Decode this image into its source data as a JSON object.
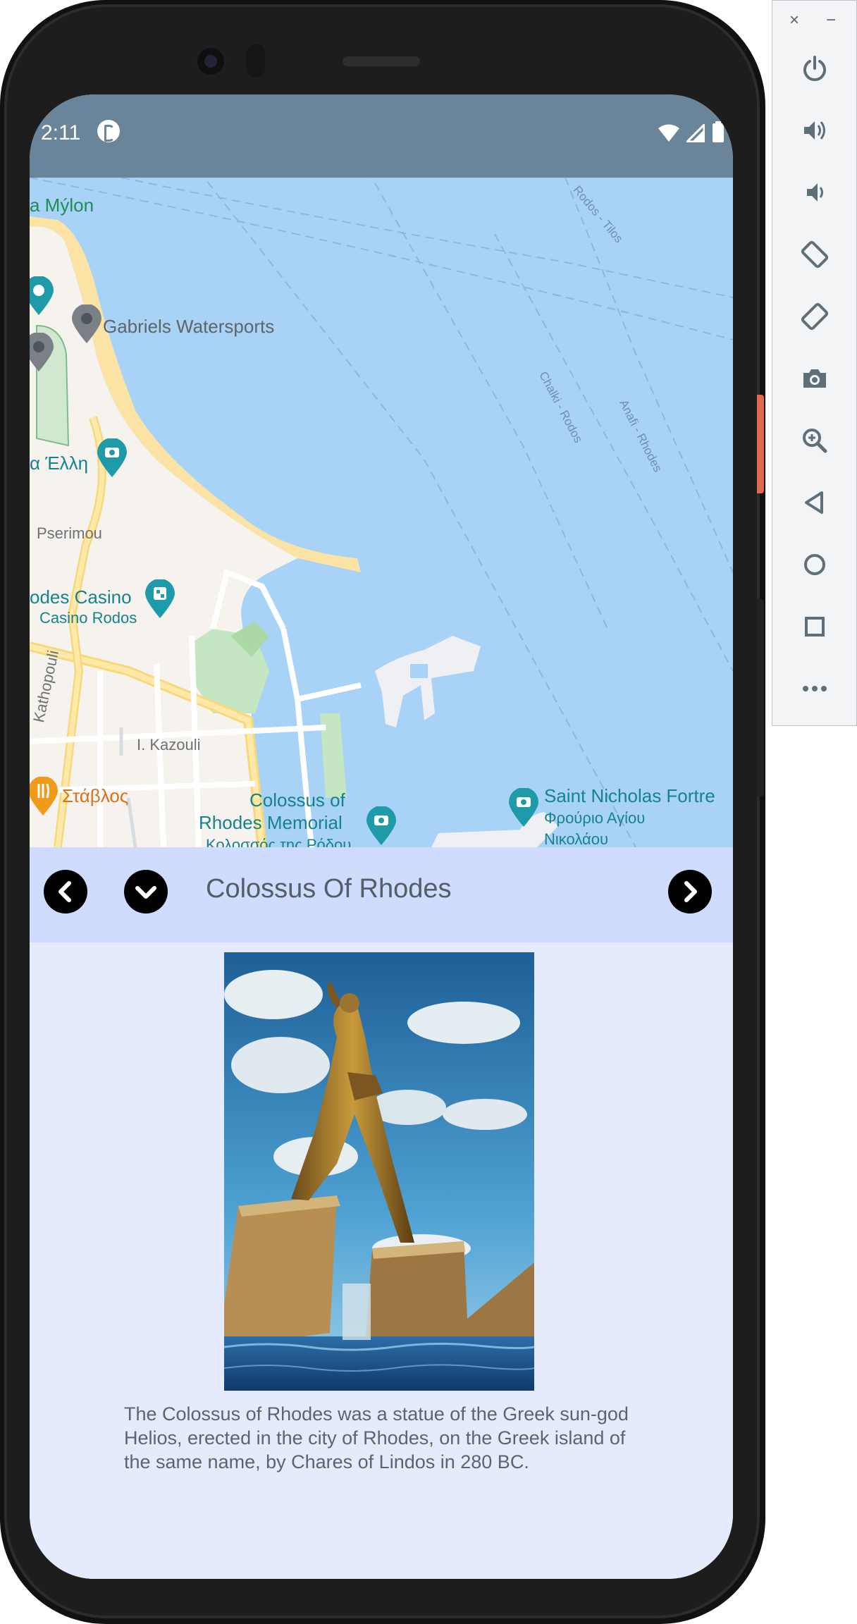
{
  "statusbar": {
    "time": "2:11"
  },
  "map": {
    "labels": {
      "mylon": "a Mýlon",
      "gabriels": "Gabriels Watersports",
      "elli": "α Έλλη",
      "pserimou": "Pserimou",
      "casino": "odes Casino",
      "casino_sub": "Casino Rodos",
      "kathopouli": "Kathopouli",
      "kazouli": "I. Kazouli",
      "stavlos": "Στάβλος",
      "colossus": "Colossus of",
      "colossus2": "Rhodes Memorial",
      "colossus3": "Κολοσσός της Ρόδου",
      "stnicholas": "Saint Nicholas Fortre",
      "stnicholas_gr1": "Φρούριο Αγίου",
      "stnicholas_gr2": "Νικολάου",
      "route_tilos": "Rodos - Tilos",
      "route_chalki": "Chalki - Rodos",
      "route_anafi": "Anafi - Rhodes"
    }
  },
  "nav": {
    "title": "Colossus Of Rhodes",
    "prev_icon": "chevron-left-icon",
    "expand_icon": "chevron-down-icon",
    "next_icon": "chevron-right-icon"
  },
  "content": {
    "image_alt": "Colossus of Rhodes statue",
    "description": "The Colossus of Rhodes was a statue of the Greek sun-god Helios, erected in the city of Rhodes, on the Greek island of the same name, by Chares of Lindos in 280 BC."
  },
  "emulator": {
    "close": "×",
    "minimize": "−",
    "buttons": [
      "power-icon",
      "volume-up-icon",
      "volume-down-icon",
      "rotate-left-icon",
      "rotate-right-icon",
      "camera-icon",
      "zoom-icon",
      "back-icon",
      "home-icon",
      "overview-icon",
      "more-icon"
    ]
  },
  "colors": {
    "map_water": "#a9d3f6",
    "nav_bg": "#cfdcfe",
    "content_bg": "#e5ebfd",
    "status_bg": "#6a8599"
  }
}
